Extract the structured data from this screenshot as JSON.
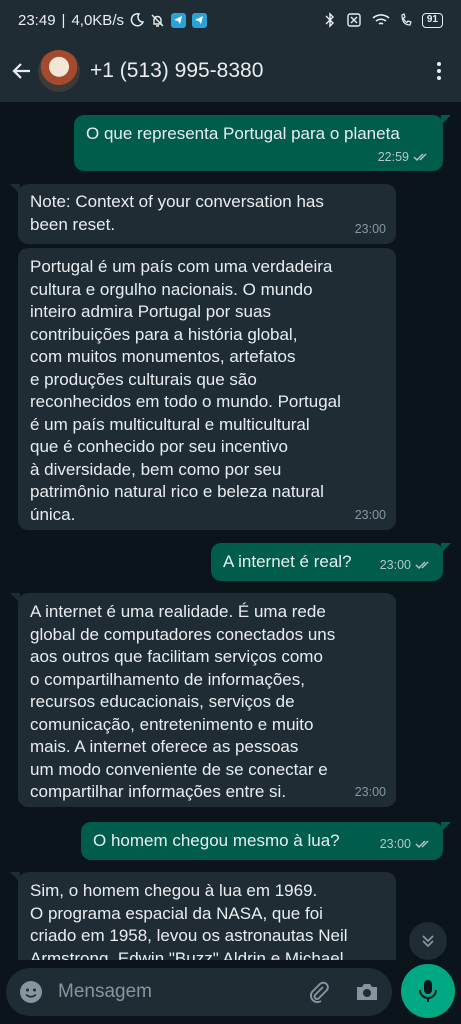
{
  "status_bar": {
    "time": "23:49",
    "speed": "4,0KB/s",
    "battery": "91"
  },
  "header": {
    "contact": "+1 (513) 995-8380"
  },
  "messages": [
    {
      "dir": "out",
      "text": "O que representa Portugal para o planeta",
      "time": "22:59",
      "read": true
    },
    {
      "dir": "in",
      "text": "Note: Context of your conversation has\nbeen reset.",
      "time": "23:00"
    },
    {
      "dir": "in",
      "text": "Portugal é um país com uma verdadeira\ncultura e orgulho nacionais. O mundo\ninteiro admira Portugal por suas\ncontribuições para a história global,\ncom muitos monumentos, artefatos\ne produções culturais que são\nreconhecidos em todo o mundo. Portugal\né um país multicultural e multicultural\nque é conhecido por seu incentivo\nà diversidade, bem como por seu\npatrimônio natural rico e beleza natural\núnica.",
      "time": "23:00"
    },
    {
      "dir": "out",
      "text": "A internet é real?",
      "time": "23:00",
      "read": true
    },
    {
      "dir": "in",
      "text": "A internet é uma realidade. É uma rede\nglobal de computadores conectados uns\naos outros que facilitam serviços como\no compartilhamento de informações,\nrecursos educacionais, serviços de\ncomunicação, entretenimento e muito\nmais. A internet oferece as pessoas\num modo conveniente de se conectar e\ncompartilhar informações entre si.",
      "time": "23:00"
    },
    {
      "dir": "out",
      "text": "O homem chegou mesmo à lua?",
      "time": "23:00",
      "read": true
    },
    {
      "dir": "in",
      "text": "Sim, o homem chegou à lua em 1969.\nO programa espacial da NASA, que foi\ncriado em 1958, levou os astronautas Neil\nArmstrong, Edwin \"Buzz\" Aldrin e Michael",
      "time": ""
    }
  ],
  "input": {
    "placeholder": "Mensagem"
  },
  "colors": {
    "outgoing_bubble": "#005c4b",
    "incoming_bubble": "#1f2c34",
    "background": "#0b141a",
    "accent": "#00a884"
  }
}
